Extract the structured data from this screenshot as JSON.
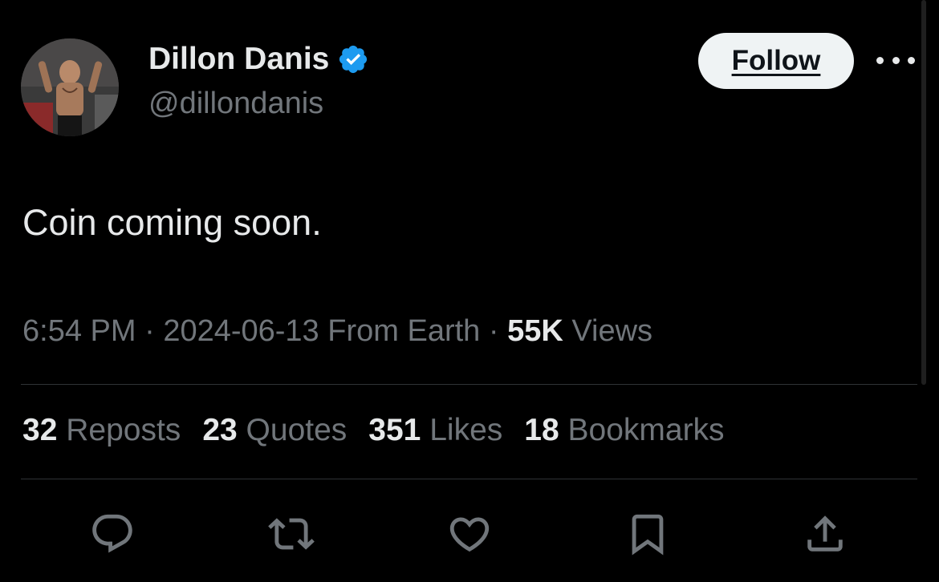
{
  "user": {
    "display_name": "Dillon Danis",
    "handle": "@dillondanis",
    "verified": true,
    "avatar_icon": "profile-photo"
  },
  "actions_top": {
    "follow_label": "Follow",
    "more_icon": "more-horizontal-icon"
  },
  "tweet": {
    "text": "Coin coming soon."
  },
  "meta": {
    "time": "6:54 PM",
    "date": "2024-06-13",
    "source": "From Earth",
    "views_count": "55K",
    "views_label": "Views",
    "separator": "·"
  },
  "stats": [
    {
      "count": "32",
      "label": "Reposts"
    },
    {
      "count": "23",
      "label": "Quotes"
    },
    {
      "count": "351",
      "label": "Likes"
    },
    {
      "count": "18",
      "label": "Bookmarks"
    }
  ],
  "action_icons": [
    "reply-icon",
    "repost-icon",
    "like-icon",
    "bookmark-icon",
    "share-icon"
  ],
  "colors": {
    "background": "#000000",
    "primary_text": "#e7e9ea",
    "secondary_text": "#71767b",
    "verified_blue": "#1d9bf0",
    "divider": "#2f3336",
    "follow_button_bg": "#eff3f4"
  }
}
